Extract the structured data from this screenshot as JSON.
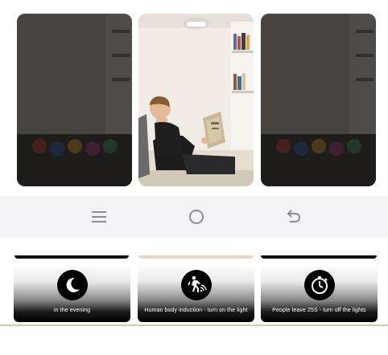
{
  "navigation": {
    "menu_icon": "menu-icon",
    "home_icon": "home-icon",
    "back_icon": "back-icon"
  },
  "photos": [
    {
      "name": "scene-left",
      "dimmed": true
    },
    {
      "name": "scene-center",
      "dimmed": false
    },
    {
      "name": "scene-right",
      "dimmed": true
    }
  ],
  "modes": [
    {
      "icon": "moon-icon",
      "label": "in the evening"
    },
    {
      "icon": "walking-person-sensor-icon",
      "label": "Human body induction - turn on the light"
    },
    {
      "icon": "timer-icon",
      "label": "People leave 25S - turn off the lights"
    }
  ],
  "colors": {
    "nav_background": "#f3f3f6",
    "icon_background": "#000000",
    "label_text": "#ffffff"
  }
}
